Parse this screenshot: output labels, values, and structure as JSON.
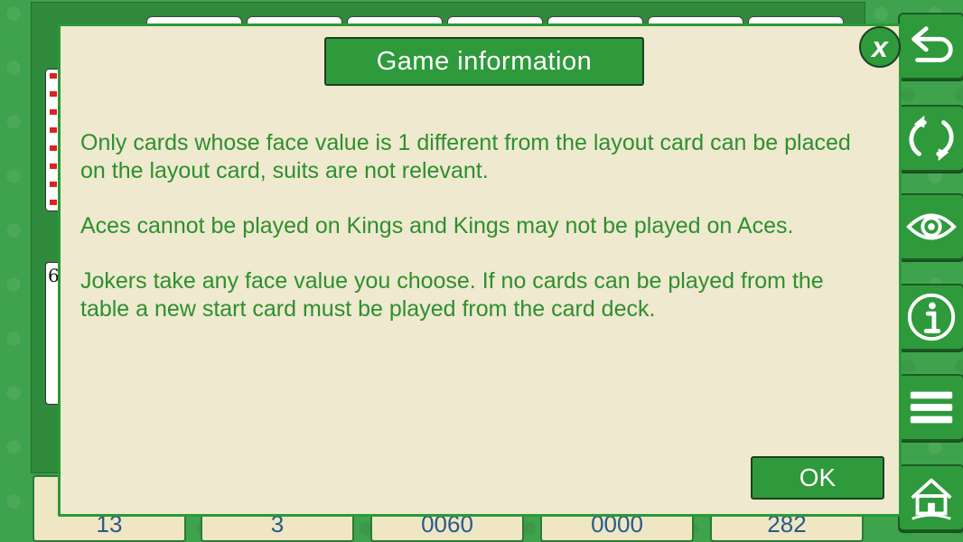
{
  "dialog": {
    "title": "Game information",
    "paragraphs": [
      "Only cards whose face value is 1 different from the layout card can be placed on the layout card, suits are not relevant.",
      "Aces cannot be played on Kings and Kings may not be played on Aces.",
      "Jokers take any face value you choose. If no cards can be played from the table a new start card must be played from the card deck."
    ],
    "ok_label": "OK",
    "close_label": "x"
  },
  "table": {
    "side_card_value": "6"
  },
  "scores": [
    "13",
    "3",
    "0060",
    "0000",
    "282"
  ],
  "toolbar": {
    "buttons": [
      "undo-icon",
      "restart-icon",
      "eye-icon",
      "info-icon",
      "menu-icon",
      "home-icon"
    ]
  },
  "colors": {
    "background": "#3fa34d",
    "dialog_bg": "#eee9cf",
    "accent": "#2f9a3c",
    "text": "#2e8f2e"
  }
}
